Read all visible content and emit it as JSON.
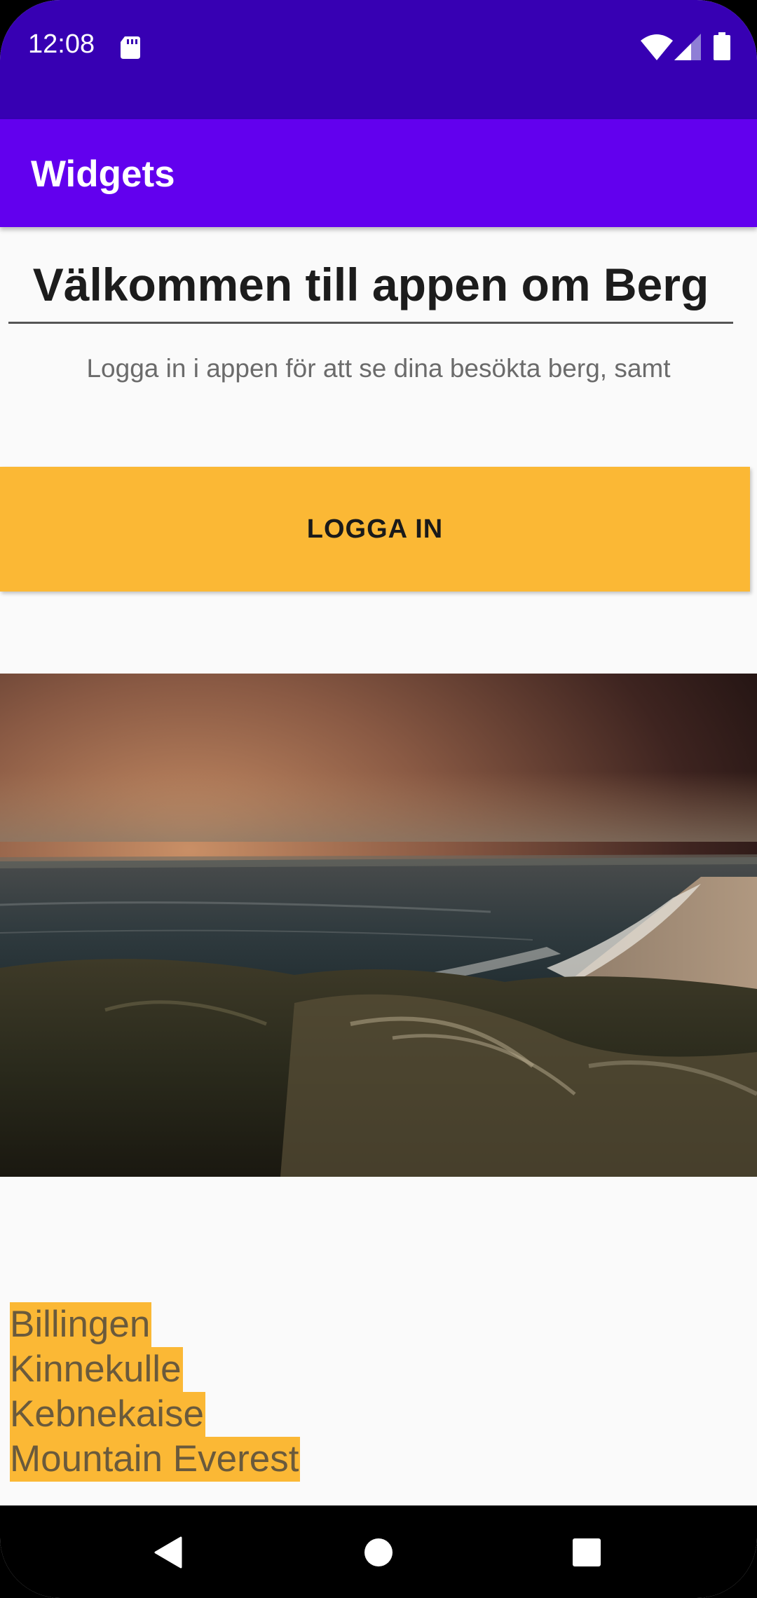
{
  "status_bar": {
    "time": "12:08",
    "icons": [
      "sd-card-icon",
      "wifi-icon",
      "signal-icon",
      "battery-icon"
    ]
  },
  "app_bar": {
    "title": "Widgets"
  },
  "content": {
    "headline": "Välkommen till appen om Berg",
    "subtitle": "Logga in i appen för att se dina besökta berg, samt",
    "login_button_label": "LOGGA IN",
    "image_icon": "landscape-image",
    "mountains": [
      "Billingen",
      "Kinnekulle",
      "Kebnekaise",
      "Mountain Everest"
    ]
  },
  "nav_bar": {
    "icons": [
      "back-icon",
      "home-icon",
      "recents-icon"
    ]
  },
  "colors": {
    "status_bar": "#3700b3",
    "app_bar": "#6200ee",
    "accent": "#fbb835",
    "background": "#fafafa"
  }
}
